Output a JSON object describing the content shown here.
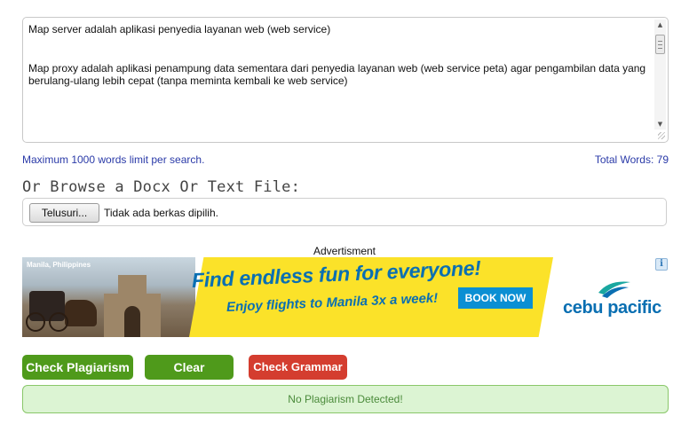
{
  "editor": {
    "text": "Map server adalah aplikasi penyedia layanan web (web service)\n\n\nMap proxy adalah aplikasi penampung data sementara dari penyedia layanan web (web service peta) agar pengambilan data yang berulang-ulang lebih cepat (tanpa meminta kembali ke web service)"
  },
  "limits": {
    "max_words_text": "Maximum 1000 words limit per search.",
    "total_words_text": "Total Words: 79"
  },
  "upload": {
    "heading": "Or Browse a Docx Or Text File:",
    "browse_label": "Telusuri...",
    "file_status": "Tidak ada berkas dipilih."
  },
  "ad": {
    "label": "Advertisment",
    "location": "Manila, Philippines",
    "headline": "Find endless fun for everyone!",
    "subline": "Enjoy flights to Manila 3x a week!",
    "cta": "BOOK NOW",
    "brand": "cebu pacific",
    "info_icon": "info-icon",
    "colors": {
      "yellow": "#fbe229",
      "blue": "#0a6fb2",
      "cta": "#0b8fd3"
    }
  },
  "actions": {
    "check_plagiarism": "Check Plagiarism",
    "clear": "Clear",
    "check_grammar": "Check Grammar"
  },
  "result": {
    "message": "No Plagiarism Detected!"
  },
  "colors": {
    "primary_green": "#4f9a1b",
    "grammar_red": "#d43d2f",
    "result_bg": "#dcf4d3",
    "link_blue": "#2a3aa8"
  }
}
